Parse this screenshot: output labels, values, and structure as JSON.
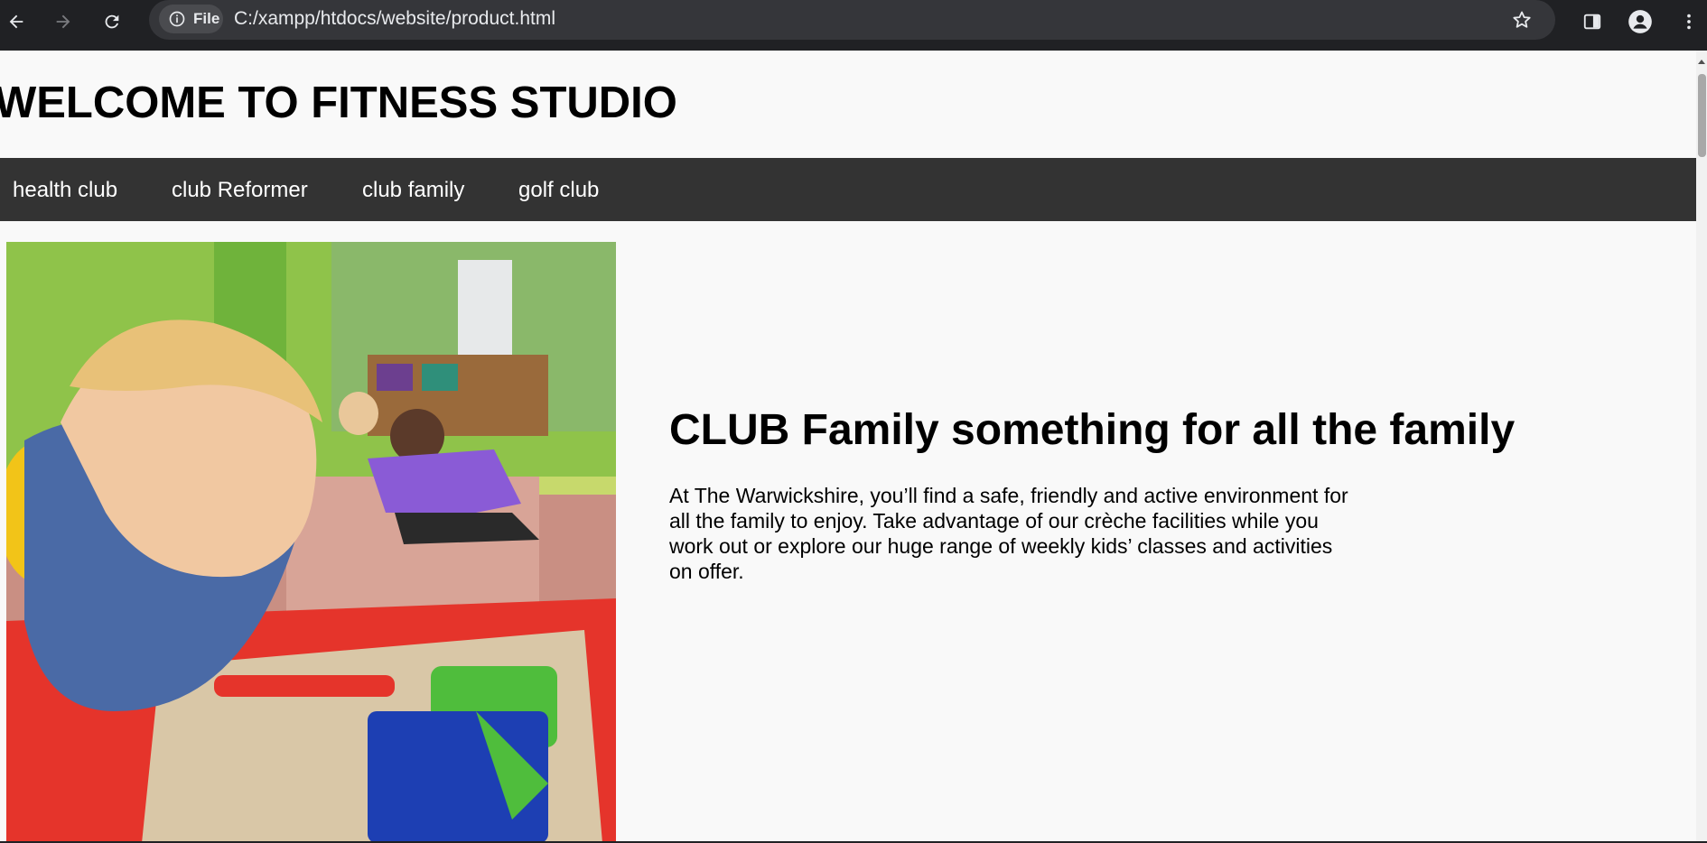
{
  "browser": {
    "site_chip_label": "File",
    "url": "C:/xampp/htdocs/website/product.html",
    "icons": [
      "back-arrow-icon",
      "forward-arrow-icon",
      "reload-icon",
      "info-icon",
      "star-icon",
      "sidebar-icon",
      "profile-icon",
      "kebab-menu-icon"
    ]
  },
  "header": {
    "title": "WELCOME TO FITNESS STUDIO"
  },
  "nav": {
    "items": [
      {
        "label": "health club"
      },
      {
        "label": "club Reformer"
      },
      {
        "label": "club family"
      },
      {
        "label": "golf club"
      }
    ],
    "background": "#333333"
  },
  "main": {
    "heading": "CLUB Family something for all the family",
    "paragraph": "At The Warwickshire, you’ll find a safe, friendly and active environment for all the family to enjoy. Take advantage of our crèche facilities while you work out or explore our huge range of weekly kids’ classes and activities on offer."
  }
}
